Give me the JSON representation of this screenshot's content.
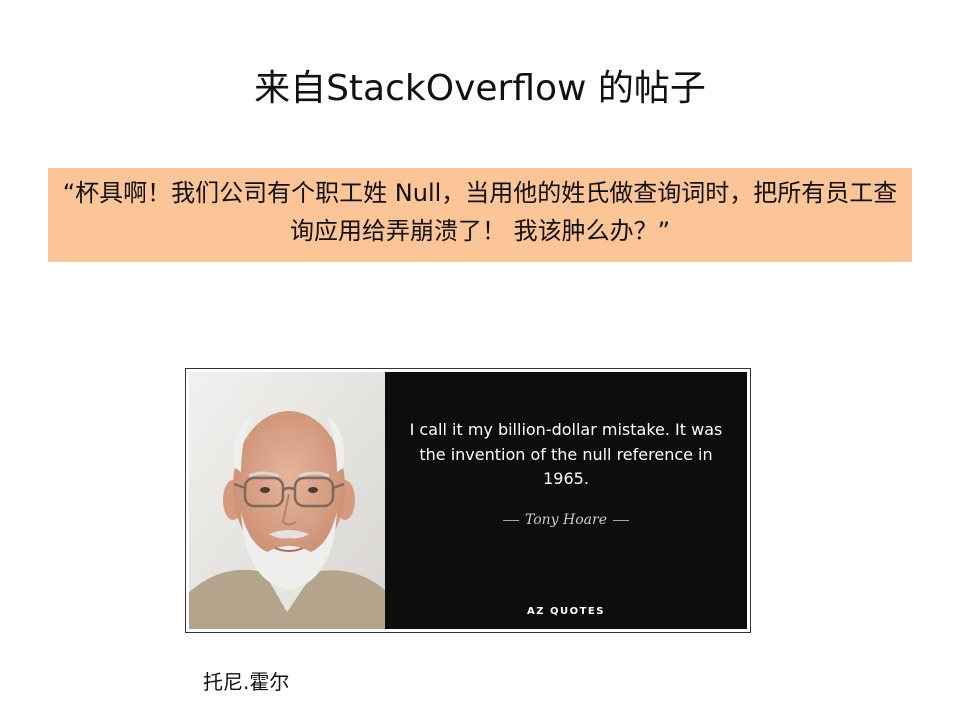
{
  "slide": {
    "title": "来自StackOverflow 的帖子",
    "quote": "“杯具啊！我们公司有个职工姓 Null，当用他的姓氏做查询词时，把所有员工查询应用给弄崩溃了！ 我该肿么办？”",
    "quote_background": "#fbc598",
    "caption": "托尼.霍尔"
  },
  "quote_card": {
    "text": "I call it my billion-dollar mistake. It was the invention of the null reference in 1965.",
    "author": "Tony Hoare",
    "brand": "AZ QUOTES",
    "background": "#0d0d0d"
  }
}
